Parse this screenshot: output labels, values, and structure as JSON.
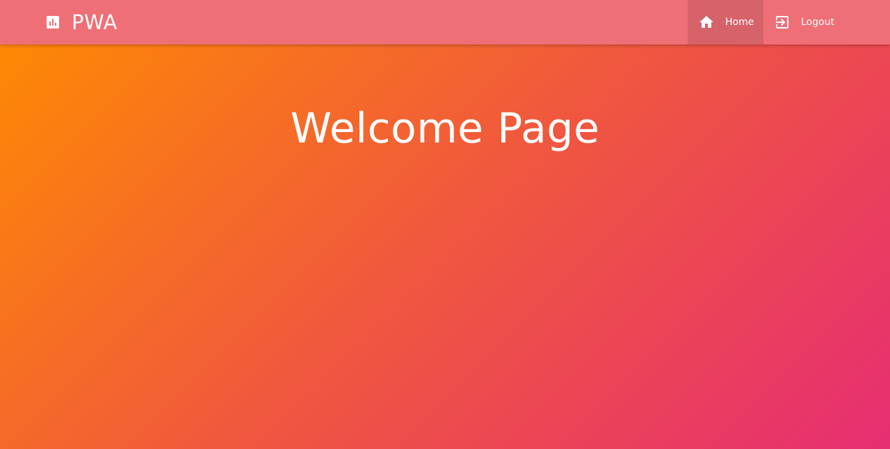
{
  "navbar": {
    "brand_icon": "bar-chart-icon",
    "brand_title": "PWA",
    "background": "#ef6f76",
    "items": [
      {
        "label": "Home",
        "icon": "home-icon",
        "active": true
      },
      {
        "label": "Logout",
        "icon": "logout-icon",
        "active": false
      }
    ]
  },
  "main": {
    "title": "Welcome Page",
    "gradient": [
      "#ff8c00",
      "#f0583e",
      "#e62e72"
    ]
  }
}
